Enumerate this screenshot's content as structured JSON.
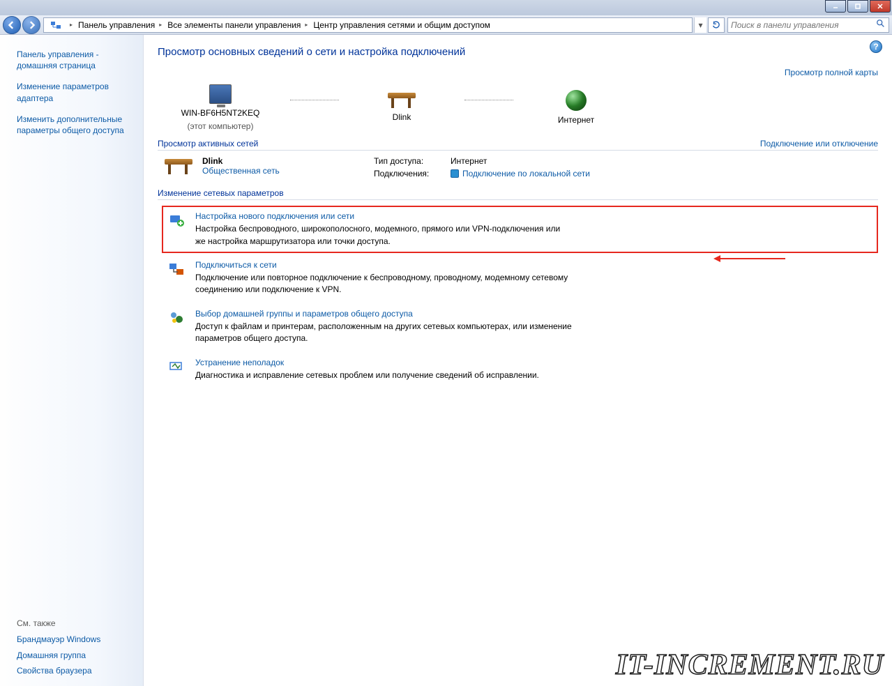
{
  "window": {
    "breadcrumbs": [
      "Панель управления",
      "Все элементы панели управления",
      "Центр управления сетями и общим доступом"
    ],
    "search_placeholder": "Поиск в панели управления"
  },
  "sidebar": {
    "links": [
      "Панель управления - домашняя страница",
      "Изменение параметров адаптера",
      "Изменить дополнительные параметры общего доступа"
    ],
    "see_also_label": "См. также",
    "see_also": [
      "Брандмауэр Windows",
      "Домашняя группа",
      "Свойства браузера"
    ]
  },
  "main": {
    "title": "Просмотр основных сведений о сети и настройка подключений",
    "view_map": "Просмотр полной карты",
    "map": {
      "node1_name": "WIN-BF6H5NT2KEQ",
      "node1_sub": "(этот компьютер)",
      "node2_name": "Dlink",
      "node3_name": "Интернет"
    },
    "active_head": "Просмотр активных сетей",
    "active_right": "Подключение или отключение",
    "active": {
      "name": "Dlink",
      "type": "Общественная сеть",
      "access_k": "Тип доступа:",
      "access_v": "Интернет",
      "conn_k": "Подключения:",
      "conn_v": "Подключение по локальной сети"
    },
    "params_head": "Изменение сетевых параметров",
    "tasks": [
      {
        "title": "Настройка нового подключения или сети",
        "desc": "Настройка беспроводного, широкополосного, модемного, прямого или VPN-подключения или же настройка маршрутизатора или точки доступа."
      },
      {
        "title": "Подключиться к сети",
        "desc": "Подключение или повторное подключение к беспроводному, проводному, модемному сетевому соединению или подключение к VPN."
      },
      {
        "title": "Выбор домашней группы и параметров общего доступа",
        "desc": "Доступ к файлам и принтерам, расположенным на других сетевых компьютерах, или изменение параметров общего доступа."
      },
      {
        "title": "Устранение неполадок",
        "desc": "Диагностика и исправление сетевых проблем или получение сведений об исправлении."
      }
    ]
  },
  "watermark": "IT-INCREMENT.RU"
}
